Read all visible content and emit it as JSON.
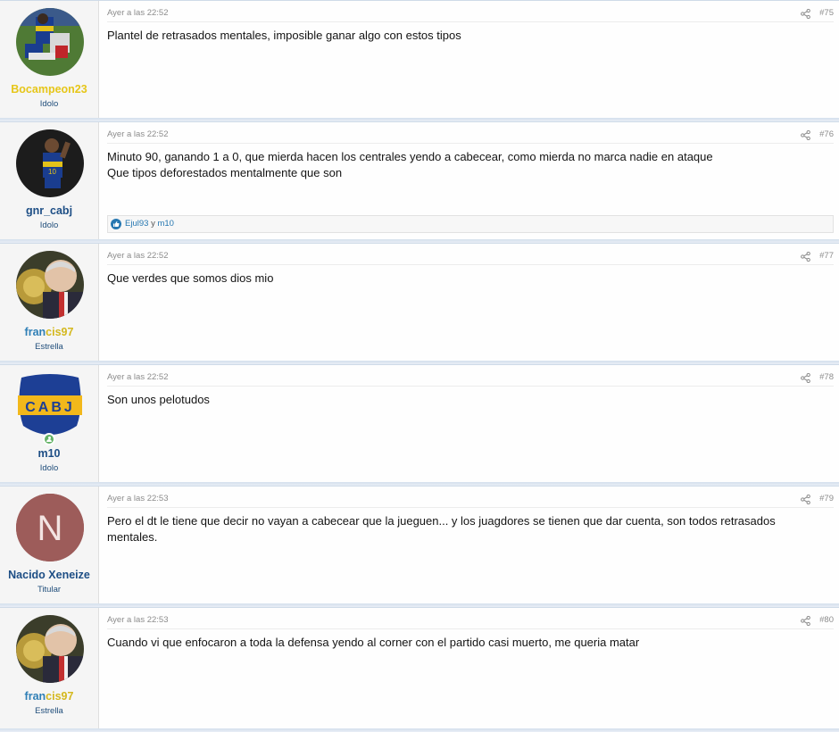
{
  "colors": {
    "username_yellow": "#e6c619",
    "username_blue": "#1d4e85",
    "francis_blue": "#2f7fb6",
    "francis_yellow": "#d4b81e",
    "usertitle": "#1f4d7a",
    "meta_gray": "#8c8c8c",
    "like_blue": "#2577b1"
  },
  "posts": [
    {
      "date": "Ayer a las 22:52",
      "number": "#75",
      "username": "Bocampeon23",
      "usertitle": "Idolo",
      "lines": [
        "Plantel de retrasados mentales, imposible ganar algo con estos tipos"
      ]
    },
    {
      "date": "Ayer a las 22:52",
      "number": "#76",
      "username": "gnr_cabj",
      "usertitle": "Idolo",
      "lines": [
        "Minuto 90, ganando 1 a 0, que mierda hacen los centrales yendo a cabecear, como mierda no marca nadie en ataque",
        "Que tipos deforestados mentalmente que son"
      ],
      "reactions": {
        "icon": "like-icon",
        "user1": "Ejul93",
        "joiner": "y",
        "user2": "m10"
      }
    },
    {
      "date": "Ayer a las 22:52",
      "number": "#77",
      "username_part1": "fran",
      "username_part2": "cis97",
      "usertitle": "Estrella",
      "lines": [
        "Que verdes que somos dios mio"
      ]
    },
    {
      "date": "Ayer a las 22:52",
      "number": "#78",
      "username": "m10",
      "usertitle": "Idolo",
      "avatar_text": "CABJ",
      "lines": [
        "Son unos pelotudos"
      ]
    },
    {
      "date": "Ayer a las 22:53",
      "number": "#79",
      "username": "Nacido Xeneize",
      "usertitle": "Titular",
      "avatar_letter": "N",
      "lines": [
        "Pero el dt le tiene que decir no vayan a cabecear que la jueguen... y los juagdores se tienen que dar cuenta, son todos retrasados mentales."
      ]
    },
    {
      "date": "Ayer a las 22:53",
      "number": "#80",
      "username_part1": "fran",
      "username_part2": "cis97",
      "usertitle": "Estrella",
      "lines": [
        "Cuando vi que enfocaron a toda la defensa yendo al corner con el partido casi muerto, me queria matar"
      ]
    }
  ]
}
